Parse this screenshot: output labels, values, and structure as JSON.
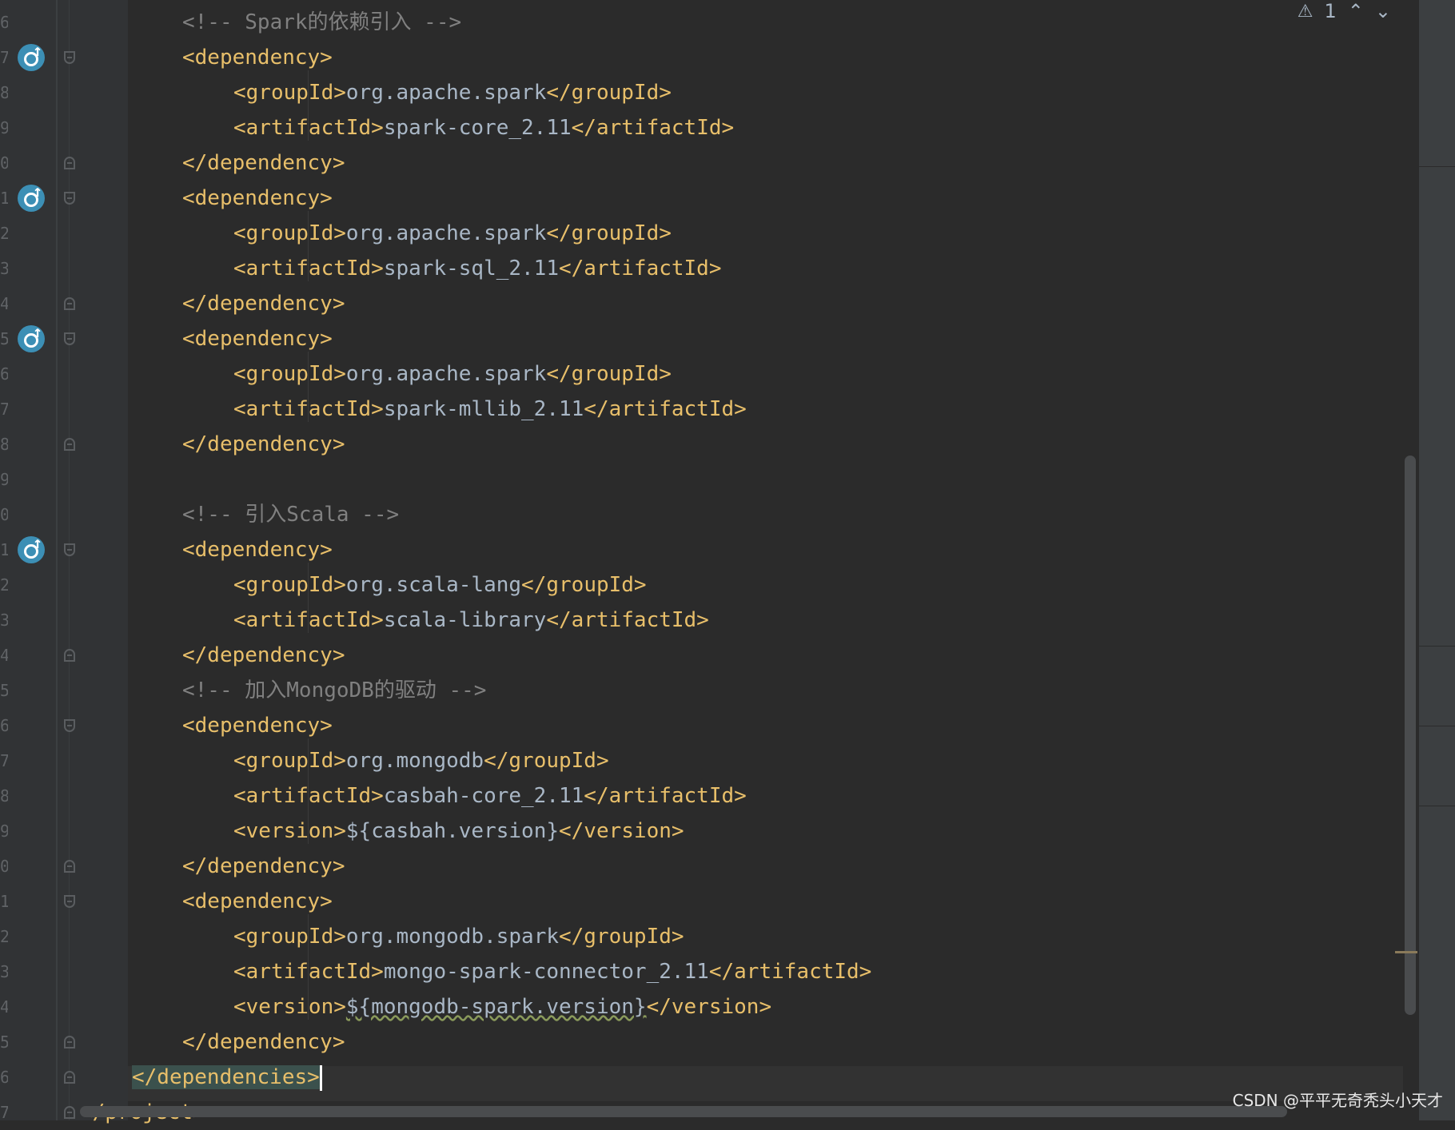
{
  "inspections": {
    "warning_icon": "warning-triangle-icon",
    "warning_count": "1"
  },
  "code_lines": [
    {
      "kind": "comment",
      "indent": 1,
      "text": "<!-- Spark的依赖引入 -->"
    },
    {
      "kind": "open",
      "indent": 1,
      "tag": "dependency"
    },
    {
      "kind": "elem",
      "indent": 2,
      "tag": "groupId",
      "value": "org.apache.spark"
    },
    {
      "kind": "elem",
      "indent": 2,
      "tag": "artifactId",
      "value": "spark-core_2.11"
    },
    {
      "kind": "close",
      "indent": 1,
      "tag": "dependency"
    },
    {
      "kind": "open",
      "indent": 1,
      "tag": "dependency"
    },
    {
      "kind": "elem",
      "indent": 2,
      "tag": "groupId",
      "value": "org.apache.spark"
    },
    {
      "kind": "elem",
      "indent": 2,
      "tag": "artifactId",
      "value": "spark-sql_2.11"
    },
    {
      "kind": "close",
      "indent": 1,
      "tag": "dependency"
    },
    {
      "kind": "open",
      "indent": 1,
      "tag": "dependency"
    },
    {
      "kind": "elem",
      "indent": 2,
      "tag": "groupId",
      "value": "org.apache.spark"
    },
    {
      "kind": "elem",
      "indent": 2,
      "tag": "artifactId",
      "value": "spark-mllib_2.11"
    },
    {
      "kind": "close",
      "indent": 1,
      "tag": "dependency"
    },
    {
      "kind": "blank",
      "indent": 0,
      "text": ""
    },
    {
      "kind": "comment",
      "indent": 1,
      "text": "<!-- 引入Scala -->"
    },
    {
      "kind": "open",
      "indent": 1,
      "tag": "dependency"
    },
    {
      "kind": "elem",
      "indent": 2,
      "tag": "groupId",
      "value": "org.scala-lang"
    },
    {
      "kind": "elem",
      "indent": 2,
      "tag": "artifactId",
      "value": "scala-library"
    },
    {
      "kind": "close",
      "indent": 1,
      "tag": "dependency"
    },
    {
      "kind": "comment",
      "indent": 1,
      "text": "<!-- 加入MongoDB的驱动 -->"
    },
    {
      "kind": "open",
      "indent": 1,
      "tag": "dependency"
    },
    {
      "kind": "elem",
      "indent": 2,
      "tag": "groupId",
      "value": "org.mongodb"
    },
    {
      "kind": "elem",
      "indent": 2,
      "tag": "artifactId",
      "value": "casbah-core_2.11"
    },
    {
      "kind": "elem",
      "indent": 2,
      "tag": "version",
      "value": "${casbah.version}"
    },
    {
      "kind": "close",
      "indent": 1,
      "tag": "dependency"
    },
    {
      "kind": "open",
      "indent": 1,
      "tag": "dependency"
    },
    {
      "kind": "elem",
      "indent": 2,
      "tag": "groupId",
      "value": "org.mongodb.spark"
    },
    {
      "kind": "elem",
      "indent": 2,
      "tag": "artifactId",
      "value": "mongo-spark-connector_2.11"
    },
    {
      "kind": "elem",
      "indent": 2,
      "tag": "version",
      "value": "${mongodb-spark.version}",
      "wavy": true
    },
    {
      "kind": "close",
      "indent": 1,
      "tag": "dependency"
    },
    {
      "kind": "close",
      "indent": 0,
      "tag": "dependencies",
      "current": true
    },
    {
      "kind": "close",
      "indent": -1,
      "tag": "project"
    }
  ],
  "watermark": "CSDN @平平无奇秃头小天才"
}
